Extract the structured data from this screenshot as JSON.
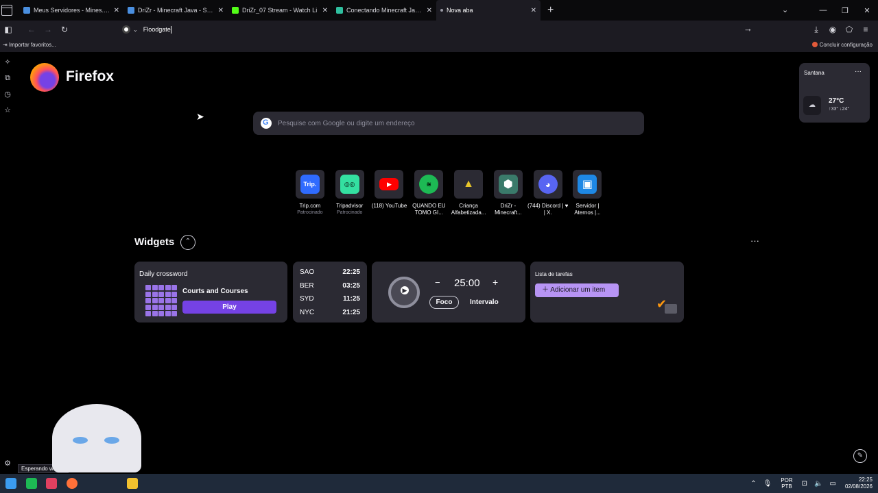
{
  "tabs": [
    {
      "title": "Meus Servidores - Mines.host",
      "color": "#4a8fe0",
      "active": false
    },
    {
      "title": "DriZr - Minecraft Java - Surviva",
      "color": "#4a8fe0",
      "active": false
    },
    {
      "title": "DriZr_07 Stream - Watch Li",
      "color": "#53fc18",
      "active": false
    },
    {
      "title": "Conectando Minecraft Java e B",
      "color": "#2fbf9f",
      "active": false
    },
    {
      "title": "Nova aba",
      "color": "#9a9aa5",
      "active": true
    }
  ],
  "urlbar": {
    "value": "Floodgate"
  },
  "bookmarks": {
    "import_label": "Importar favoritos...",
    "setup_label": "Concluir configuração"
  },
  "brand": {
    "name": "Firefox"
  },
  "search": {
    "placeholder": "Pesquise com Google ou digite um endereço"
  },
  "shortcuts": [
    {
      "label": "Trip.com",
      "sponsored": "Patrocinado",
      "icon": "trip-icon",
      "glyph": "Trip.",
      "color": "#2f6bff"
    },
    {
      "label": "Tripadvisor",
      "sponsored": "Patrocinado",
      "icon": "tripadvisor-icon",
      "glyph": "◎◎",
      "color": "#34e0a1"
    },
    {
      "label": "(118) YouTube",
      "sponsored": "",
      "icon": "youtube-icon",
      "glyph": "▶",
      "color": "#ff0000"
    },
    {
      "label": "QUANDO EU TOMO GI...",
      "sponsored": "",
      "icon": "spotify-icon",
      "glyph": "≋",
      "color": "#1db954"
    },
    {
      "label": "Criança Alfabetizada...",
      "sponsored": "",
      "icon": "pencil-cone-icon",
      "glyph": "▲",
      "color": "#e8c52a"
    },
    {
      "label": "DriZr - Minecraft...",
      "sponsored": "",
      "icon": "minecraft-server-icon",
      "glyph": "⬢",
      "color": "#3a7a6a"
    },
    {
      "label": "(744) Discord | ♥ | X.",
      "sponsored": "",
      "icon": "discord-icon",
      "glyph": "◕",
      "color": "#5865f2"
    },
    {
      "label": "Servidor | Aternos |...",
      "sponsored": "",
      "icon": "aternos-icon",
      "glyph": "▣",
      "color": "#1e88e5"
    }
  ],
  "widgets": {
    "title": "Widgets",
    "crossword": {
      "header": "Daily crossword",
      "puzzle": "Courts and Courses",
      "play": "Play"
    },
    "clocks": [
      {
        "city": "SAO",
        "time": "22:25"
      },
      {
        "city": "BER",
        "time": "03:25"
      },
      {
        "city": "SYD",
        "time": "11:25"
      },
      {
        "city": "NYC",
        "time": "21:25"
      }
    ],
    "timer": {
      "minus": "−",
      "time": "25:00",
      "plus": "+",
      "focus": "Foco",
      "break": "Intervalo"
    },
    "tasks": {
      "header": "Lista de tarefas",
      "add": "Adicionar um item"
    }
  },
  "weather": {
    "city": "Santana",
    "temp": "27°C",
    "high": "↑33°",
    "low": "↓24°"
  },
  "status": {
    "text": "Esperando www.g"
  },
  "taskbar": {
    "lang": "POR",
    "layout": "PTB",
    "time": "22:25",
    "date": "02/08/2026"
  }
}
